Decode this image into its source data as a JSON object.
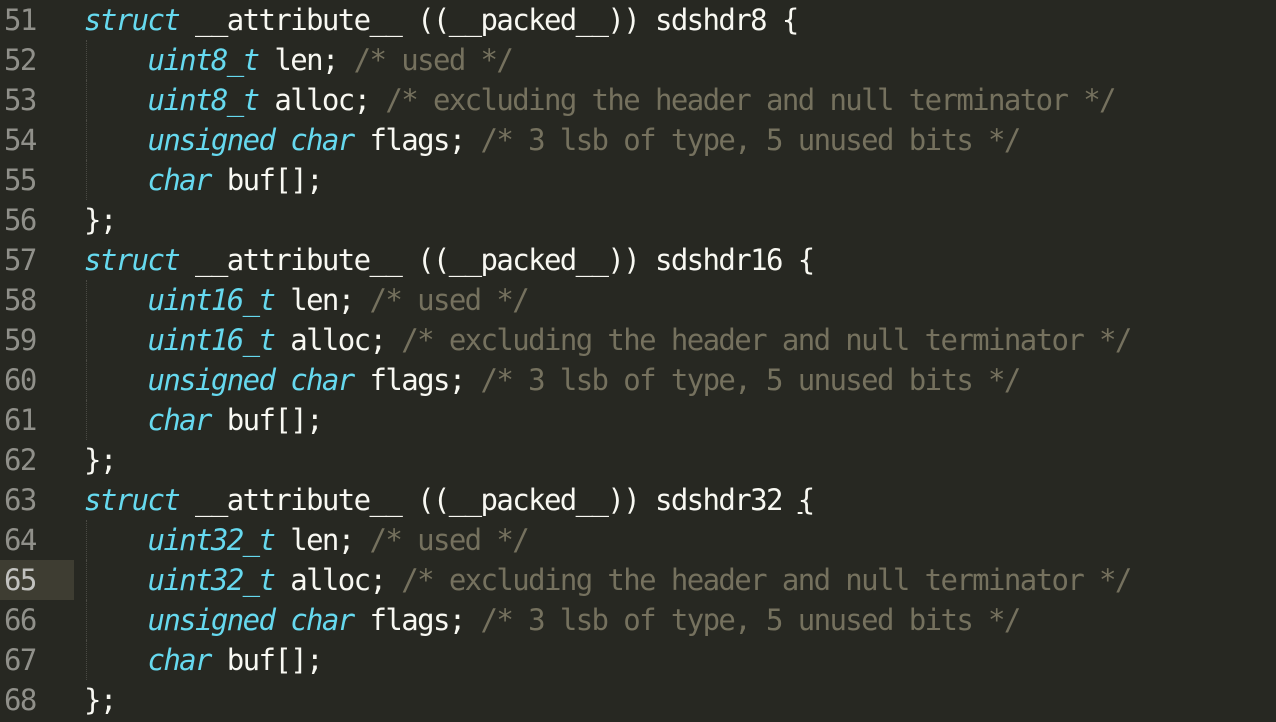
{
  "editor": {
    "current_line": 65,
    "colors": {
      "background": "#272822",
      "type_keyword": "#66D9EF",
      "comment": "#75715E",
      "text": "#F8F8F2",
      "line_number": "#90908A"
    },
    "lines": [
      {
        "num": "51",
        "indent": false,
        "tokens": [
          {
            "t": "kw",
            "v": "struct"
          },
          {
            "t": "pl",
            "v": " __attribute__ ((__packed__)) sdshdr8 {"
          }
        ]
      },
      {
        "num": "52",
        "indent": true,
        "tokens": [
          {
            "t": "pl",
            "v": "    "
          },
          {
            "t": "kw",
            "v": "uint8_t"
          },
          {
            "t": "pl",
            "v": " len; "
          },
          {
            "t": "cm",
            "v": "/* used */"
          }
        ]
      },
      {
        "num": "53",
        "indent": true,
        "tokens": [
          {
            "t": "pl",
            "v": "    "
          },
          {
            "t": "kw",
            "v": "uint8_t"
          },
          {
            "t": "pl",
            "v": " alloc; "
          },
          {
            "t": "cm",
            "v": "/* excluding the header and null terminator */"
          }
        ]
      },
      {
        "num": "54",
        "indent": true,
        "tokens": [
          {
            "t": "pl",
            "v": "    "
          },
          {
            "t": "kw",
            "v": "unsigned char"
          },
          {
            "t": "pl",
            "v": " flags; "
          },
          {
            "t": "cm",
            "v": "/* 3 lsb of type, 5 unused bits */"
          }
        ]
      },
      {
        "num": "55",
        "indent": true,
        "tokens": [
          {
            "t": "pl",
            "v": "    "
          },
          {
            "t": "kw",
            "v": "char"
          },
          {
            "t": "pl",
            "v": " buf[];"
          }
        ]
      },
      {
        "num": "56",
        "indent": false,
        "tokens": [
          {
            "t": "pl",
            "v": "};"
          }
        ]
      },
      {
        "num": "57",
        "indent": false,
        "tokens": [
          {
            "t": "kw",
            "v": "struct"
          },
          {
            "t": "pl",
            "v": " __attribute__ ((__packed__)) sdshdr16 {"
          }
        ]
      },
      {
        "num": "58",
        "indent": true,
        "tokens": [
          {
            "t": "pl",
            "v": "    "
          },
          {
            "t": "kw",
            "v": "uint16_t"
          },
          {
            "t": "pl",
            "v": " len; "
          },
          {
            "t": "cm",
            "v": "/* used */"
          }
        ]
      },
      {
        "num": "59",
        "indent": true,
        "tokens": [
          {
            "t": "pl",
            "v": "    "
          },
          {
            "t": "kw",
            "v": "uint16_t"
          },
          {
            "t": "pl",
            "v": " alloc; "
          },
          {
            "t": "cm",
            "v": "/* excluding the header and null terminator */"
          }
        ]
      },
      {
        "num": "60",
        "indent": true,
        "tokens": [
          {
            "t": "pl",
            "v": "    "
          },
          {
            "t": "kw",
            "v": "unsigned char"
          },
          {
            "t": "pl",
            "v": " flags; "
          },
          {
            "t": "cm",
            "v": "/* 3 lsb of type, 5 unused bits */"
          }
        ]
      },
      {
        "num": "61",
        "indent": true,
        "tokens": [
          {
            "t": "pl",
            "v": "    "
          },
          {
            "t": "kw",
            "v": "char"
          },
          {
            "t": "pl",
            "v": " buf[];"
          }
        ]
      },
      {
        "num": "62",
        "indent": false,
        "tokens": [
          {
            "t": "pl",
            "v": "};"
          }
        ]
      },
      {
        "num": "63",
        "indent": false,
        "tokens": [
          {
            "t": "kw",
            "v": "struct"
          },
          {
            "t": "pl",
            "v": " __attribute__ ((__packed__)) sdshdr32 "
          },
          {
            "t": "ul",
            "v": "{"
          }
        ]
      },
      {
        "num": "64",
        "indent": true,
        "tokens": [
          {
            "t": "pl",
            "v": "    "
          },
          {
            "t": "kw",
            "v": "uint32_t"
          },
          {
            "t": "pl",
            "v": " len; "
          },
          {
            "t": "cm",
            "v": "/* used */"
          }
        ]
      },
      {
        "num": "65",
        "indent": true,
        "tokens": [
          {
            "t": "pl",
            "v": "    "
          },
          {
            "t": "kw",
            "v": "uint32_t"
          },
          {
            "t": "pl",
            "v": " alloc; "
          },
          {
            "t": "cm",
            "v": "/* excluding the header and null terminator */"
          }
        ]
      },
      {
        "num": "66",
        "indent": true,
        "tokens": [
          {
            "t": "pl",
            "v": "    "
          },
          {
            "t": "kw",
            "v": "unsigned char"
          },
          {
            "t": "pl",
            "v": " flags; "
          },
          {
            "t": "cm",
            "v": "/* 3 lsb of type, 5 unused bits */"
          }
        ]
      },
      {
        "num": "67",
        "indent": true,
        "tokens": [
          {
            "t": "pl",
            "v": "    "
          },
          {
            "t": "kw",
            "v": "char"
          },
          {
            "t": "pl",
            "v": " buf[];"
          }
        ]
      },
      {
        "num": "68",
        "indent": false,
        "tokens": [
          {
            "t": "pl",
            "v": "};"
          }
        ]
      }
    ]
  }
}
